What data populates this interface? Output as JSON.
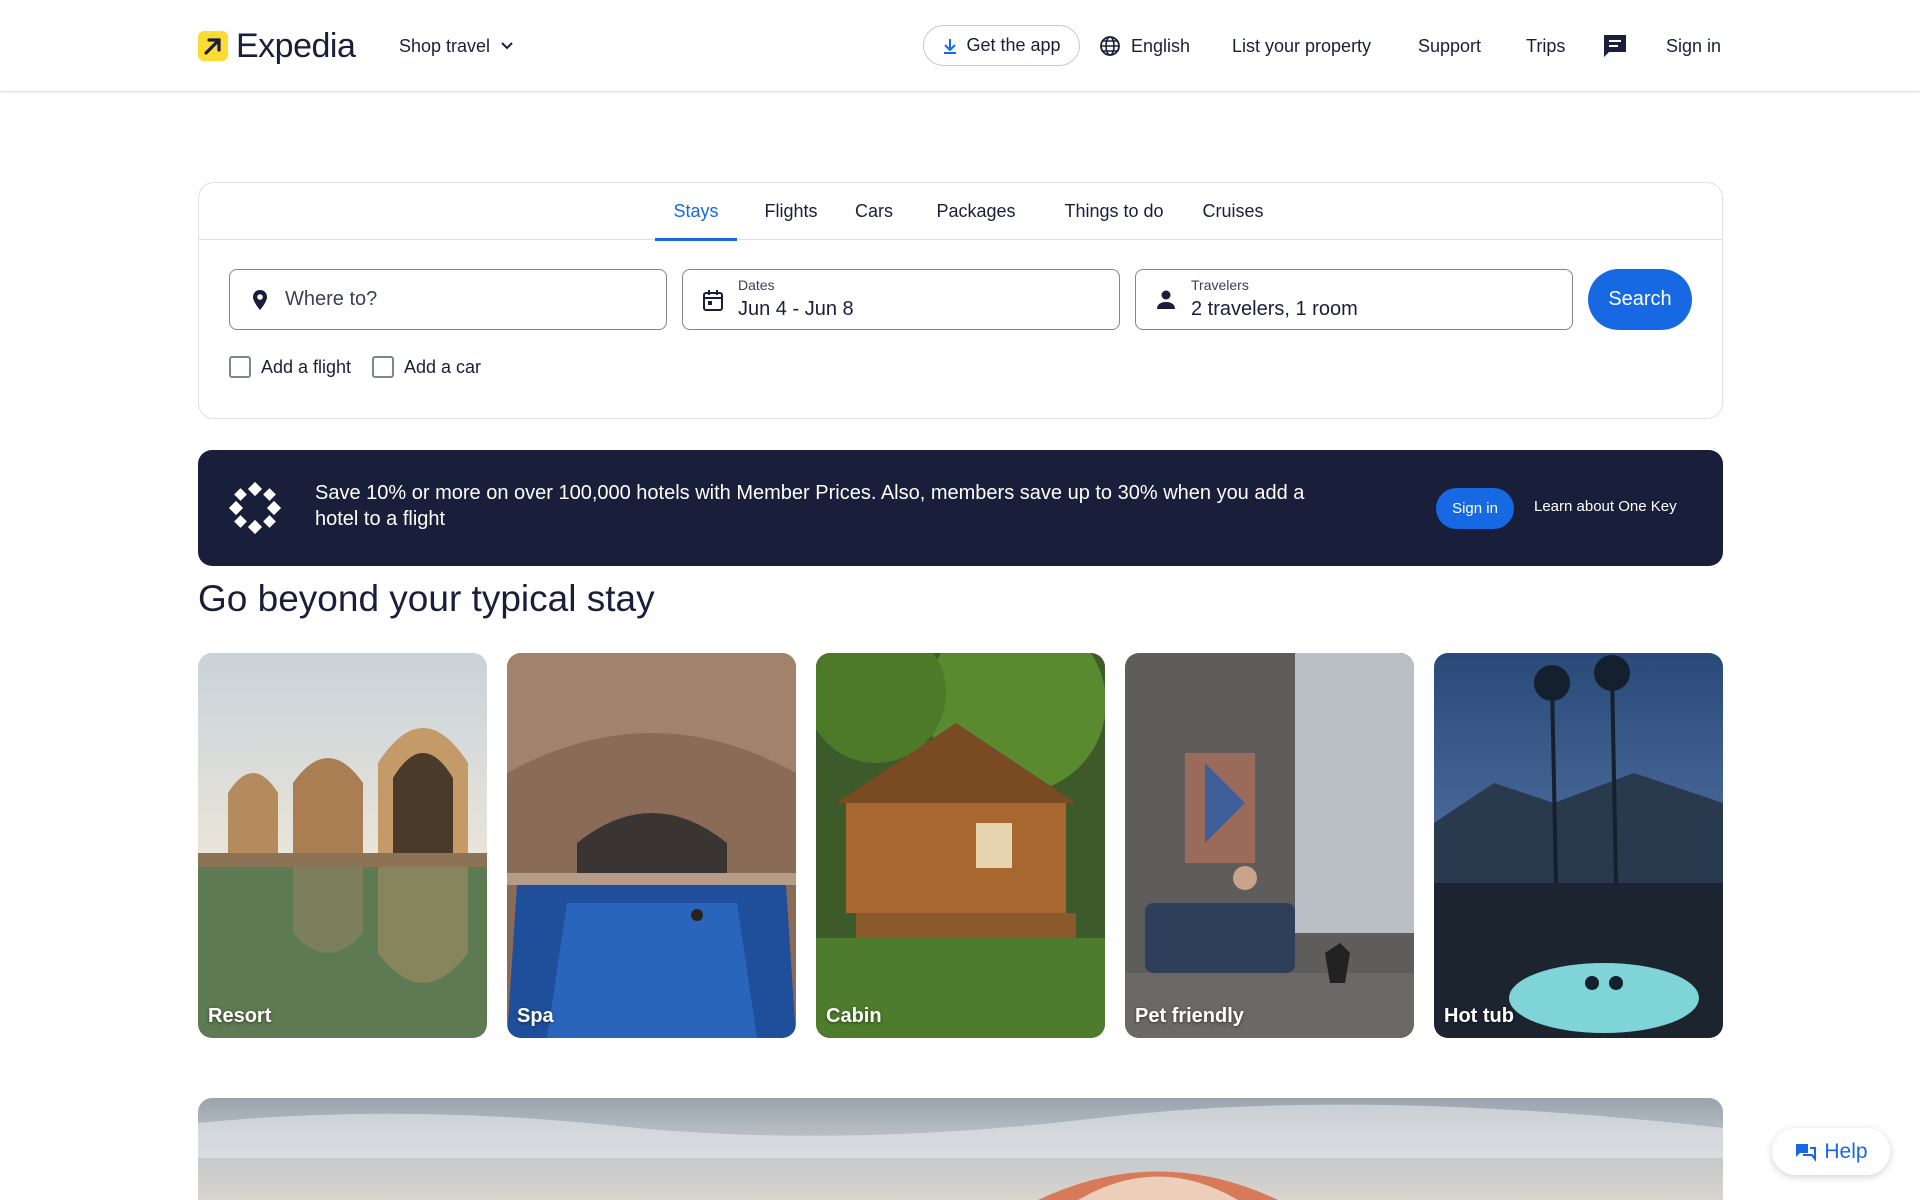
{
  "header": {
    "logo_text": "Expedia",
    "shop_travel": "Shop travel",
    "get_app": "Get the app",
    "language": "English",
    "list_property": "List your property",
    "support": "Support",
    "trips": "Trips",
    "sign_in": "Sign in"
  },
  "search": {
    "tabs": [
      "Stays",
      "Flights",
      "Cars",
      "Packages",
      "Things to do",
      "Cruises"
    ],
    "active_tab": "Stays",
    "destination_placeholder": "Where to?",
    "dates_label": "Dates",
    "dates_value": "Jun 4 - Jun 8",
    "travelers_label": "Travelers",
    "travelers_value": "2 travelers, 1 room",
    "search_button": "Search",
    "add_flight": "Add a flight",
    "add_car": "Add a car"
  },
  "banner": {
    "text": "Save 10% or more on over 100,000 hotels with Member Prices. Also, members save up to 30% when you add a hotel to a flight",
    "sign_in": "Sign in",
    "learn_more": "Learn about One Key"
  },
  "section": {
    "title": "Go beyond your typical stay",
    "cards": [
      "Resort",
      "Spa",
      "Cabin",
      "Pet friendly",
      "Hot tub"
    ]
  },
  "help": {
    "label": "Help"
  },
  "colors": {
    "brand_blue": "#1668e3",
    "navy": "#191e3b",
    "logo_yellow": "#fddb32"
  }
}
